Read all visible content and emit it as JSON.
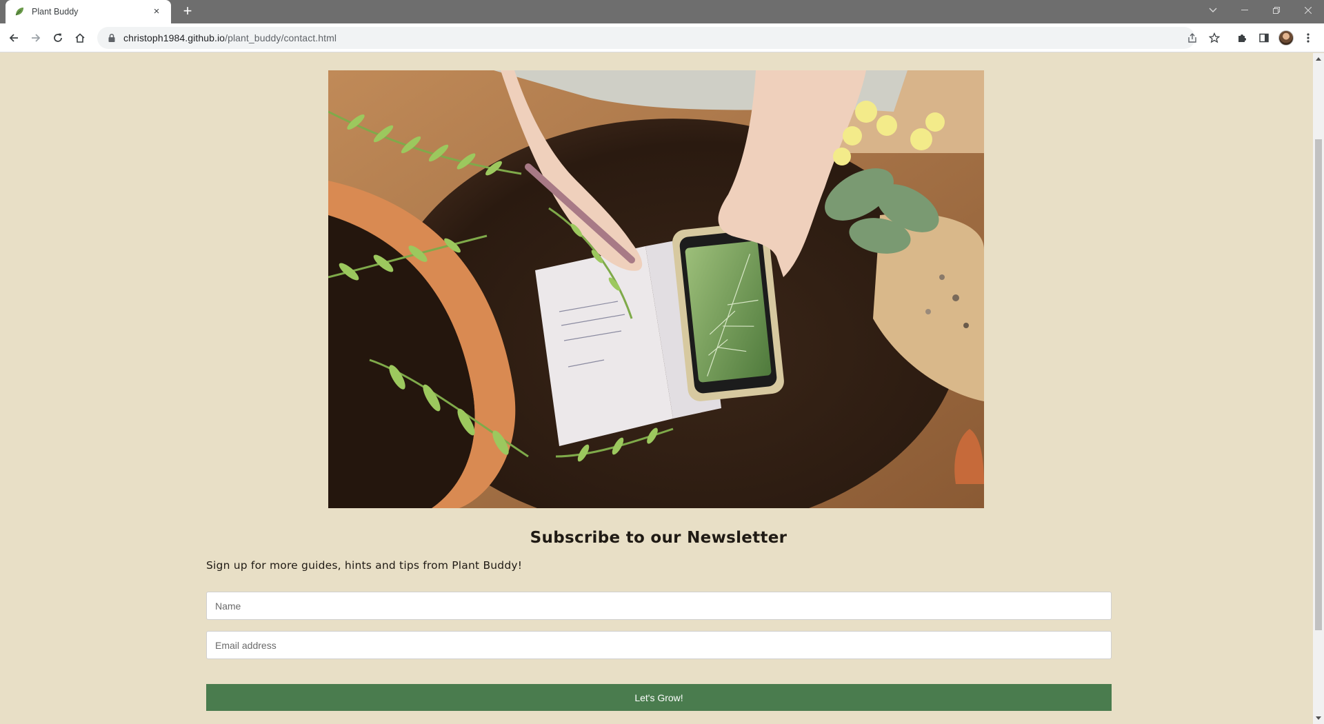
{
  "browser": {
    "tab_title": "Plant Buddy",
    "tab_close": "×",
    "new_tab": "+",
    "url_host": "christoph1984.github.io",
    "url_path": "/plant_buddy/contact.html"
  },
  "newsletter": {
    "title": "Subscribe to our Newsletter",
    "subtitle": "Sign up for more guides, hints and tips from Plant Buddy!",
    "name_placeholder": "Name",
    "email_placeholder": "Email address",
    "submit_label": "Let's Grow!"
  },
  "colors": {
    "page_bg": "#e8dfc6",
    "button_bg": "#4a7c4e"
  }
}
